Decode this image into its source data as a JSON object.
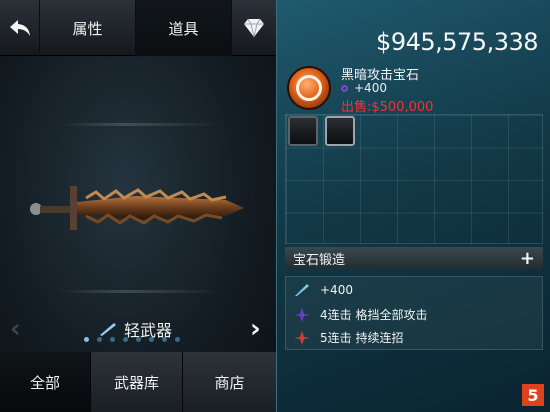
{
  "header": {
    "back_icon": "back-arrow-icon",
    "tab_attributes": "属性",
    "tab_items": "道具",
    "gem_icon": "diamond-icon"
  },
  "weapon": {
    "category_label": "轻武器",
    "carousel_total": 8,
    "carousel_active": 1
  },
  "bottom_tabs": {
    "all": "全部",
    "armory": "武器库",
    "shop": "商店"
  },
  "currency": {
    "balance": "$945,575,338"
  },
  "gem": {
    "name": "黑暗攻击宝石",
    "bonus": "+400",
    "sell_price": "出售:$500,000"
  },
  "forge": {
    "label": "宝石锻造",
    "plus": "+"
  },
  "stats": [
    {
      "icon": "blade-icon",
      "text": "+400"
    },
    {
      "icon": "purple-slash-icon",
      "text": "4连击 格挡全部攻击"
    },
    {
      "icon": "red-slash-icon",
      "text": "5连击 持续连招"
    }
  ],
  "watermark": {
    "text": "5"
  },
  "colors": {
    "accent_teal": "#1f5a6e",
    "sell_red": "#ff2e2e",
    "gem_orange": "#e0601a"
  }
}
